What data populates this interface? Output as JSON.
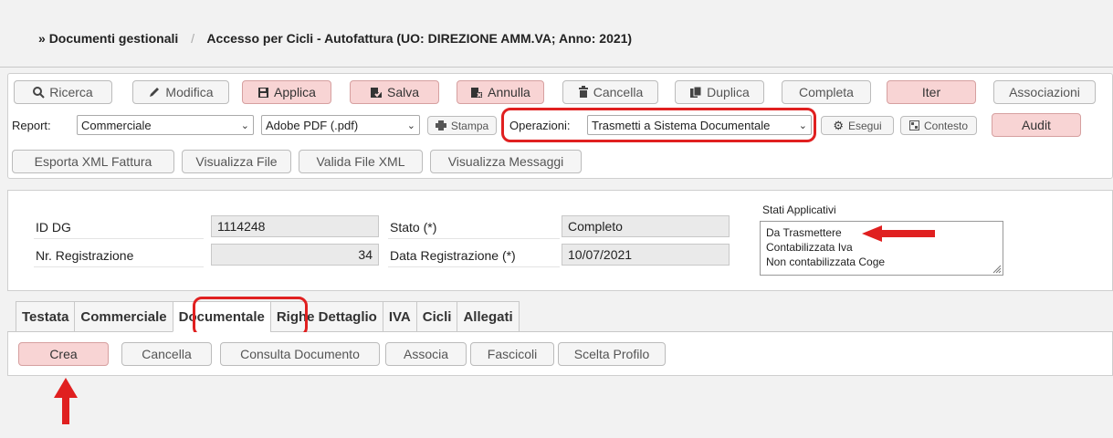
{
  "breadcrumb": {
    "prefix": "»",
    "root": "Documenti gestionali",
    "separator": "/",
    "current": "Accesso per Cicli - Autofattura (UO: DIREZIONE AMM.VA; Anno: 2021)"
  },
  "toolbar": {
    "row1": {
      "ricerca": "Ricerca",
      "modifica": "Modifica",
      "applica": "Applica",
      "salva": "Salva",
      "annulla": "Annulla",
      "cancella": "Cancella",
      "duplica": "Duplica",
      "completa": "Completa",
      "iter": "Iter",
      "associazioni": "Associazioni"
    },
    "row2": {
      "report_label": "Report:",
      "report_value": "Commerciale",
      "format_value": "Adobe PDF (.pdf)",
      "stampa": "Stampa",
      "operazioni_label": "Operazioni:",
      "operazioni_value": "Trasmetti a Sistema Documentale",
      "esegui": "Esegui",
      "contesto": "Contesto",
      "audit": "Audit"
    },
    "row3": {
      "esporta_xml": "Esporta XML Fattura",
      "visualizza_file": "Visualizza File",
      "valida_xml": "Valida File XML",
      "visualizza_messaggi": "Visualizza Messaggi"
    }
  },
  "form": {
    "id_dg_label": "ID DG",
    "id_dg_value": "1114248",
    "nr_reg_label": "Nr. Registrazione",
    "nr_reg_value": "34",
    "stato_label": "Stato (*)",
    "stato_value": "Completo",
    "data_reg_label": "Data Registrazione (*)",
    "data_reg_value": "10/07/2021",
    "stati_title": "Stati Applicativi",
    "stati": [
      "Da Trasmettere",
      "Contabilizzata Iva",
      "Non contabilizzata Coge"
    ]
  },
  "tabs": [
    "Testata",
    "Commerciale",
    "Documentale",
    "Righe Dettaglio",
    "IVA",
    "Cicli",
    "Allegati"
  ],
  "active_tab": "Documentale",
  "documentale_actions": {
    "crea": "Crea",
    "cancella": "Cancella",
    "consulta": "Consulta Documento",
    "associa": "Associa",
    "fascicoli": "Fascicoli",
    "scelta_profilo": "Scelta Profilo"
  },
  "colors": {
    "highlight_red": "#e02020",
    "pink_button": "#f8d4d4"
  },
  "icons": {
    "ricerca": "search-icon",
    "modifica": "pencil-icon",
    "applica": "floppy-icon",
    "salva": "save-check-icon",
    "annulla": "cancel-icon",
    "cancella": "trash-icon",
    "duplica": "copy-icon",
    "stampa": "printer-icon",
    "esegui": "gear-icon",
    "contesto": "context-icon"
  }
}
